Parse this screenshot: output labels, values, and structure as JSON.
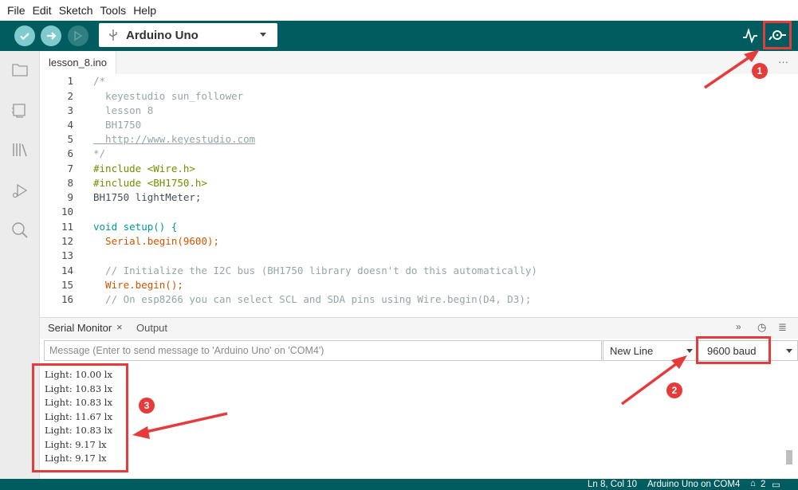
{
  "menu": [
    "File",
    "Edit",
    "Sketch",
    "Tools",
    "Help"
  ],
  "toolbar": {
    "board": "Arduino Uno",
    "verify_icon": "check-icon",
    "upload_icon": "arrow-right-icon",
    "debug_icon": "debug-icon",
    "plotter_icon": "serial-plotter-icon",
    "monitor_icon": "serial-monitor-icon"
  },
  "tabs": {
    "file": "lesson_8.ino",
    "more": "···"
  },
  "code_lines": [
    {
      "n": "1",
      "t": "/*"
    },
    {
      "n": "2",
      "t": "  keyestudio sun_follower"
    },
    {
      "n": "3",
      "t": "  lesson 8"
    },
    {
      "n": "4",
      "t": "  BH1750"
    },
    {
      "n": "5",
      "t": "  http://www.keyestudio.com"
    },
    {
      "n": "6",
      "t": "*/"
    },
    {
      "n": "7",
      "t": "#include <Wire.h>"
    },
    {
      "n": "8",
      "t": "#include <BH1750.h>"
    },
    {
      "n": "9",
      "t": "BH1750 lightMeter;"
    },
    {
      "n": "10",
      "t": ""
    },
    {
      "n": "11",
      "t": "void setup() {"
    },
    {
      "n": "12",
      "t": "  Serial.begin(9600);"
    },
    {
      "n": "13",
      "t": ""
    },
    {
      "n": "14",
      "t": "  // Initialize the I2C bus (BH1750 library doesn't do this automatically)"
    },
    {
      "n": "15",
      "t": "  Wire.begin();"
    },
    {
      "n": "16",
      "t": "  // On esp8266 you can select SCL and SDA pins using Wire.begin(D4, D3);"
    }
  ],
  "panel": {
    "tab_serial": "Serial Monitor",
    "tab_output": "Output",
    "message_placeholder": "Message (Enter to send message to 'Arduino Uno' on 'COM4')",
    "line_ending": "New Line",
    "baud": "9600 baud"
  },
  "serial_output": [
    "Light: 10.00 lx",
    "Light: 10.83 lx",
    "Light: 10.83 lx",
    "Light: 11.67 lx",
    "Light: 10.83 lx",
    "Light: 9.17 lx",
    "Light: 9.17 lx"
  ],
  "status": {
    "position": "Ln 8, Col 10",
    "board": "Arduino Uno on COM4",
    "notifications": "2"
  },
  "annotations": [
    "1",
    "2",
    "3"
  ],
  "colors": {
    "teal": "#005c5f",
    "accent": "#e53b3b",
    "button": "#7fcbcd"
  }
}
